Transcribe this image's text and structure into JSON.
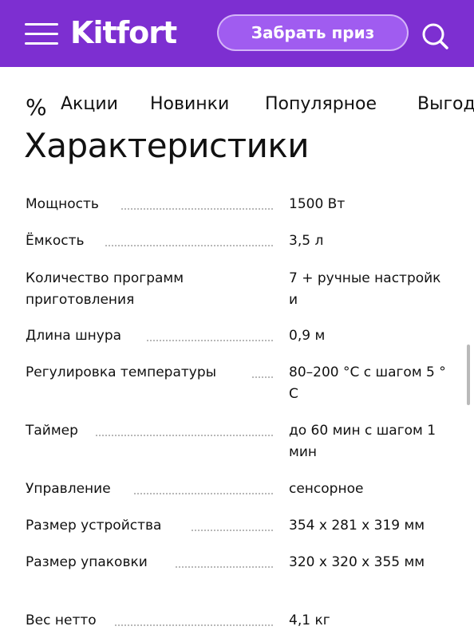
{
  "header": {
    "logo": "Kitfort",
    "prize_button": "Забрать приз",
    "menu_icon": "hamburger-menu-icon",
    "search_icon": "search-icon",
    "bg_color": "#7d2fd1",
    "button_color": "#a05cf0"
  },
  "nav": {
    "percent_symbol": "%",
    "items": [
      "Акции",
      "Новинки",
      "Популярное",
      "Выгод"
    ]
  },
  "page_title": "Характеристики",
  "specs": [
    {
      "name": "Мощность",
      "value": "1500 Вт"
    },
    {
      "name": "Ёмкость",
      "value": "3,5 л"
    },
    {
      "name": "Количество программ приготовления",
      "value": "7 + ручные настройки"
    },
    {
      "name": "Длина шнура",
      "value": "0,9 м"
    },
    {
      "name": "Регулировка температуры",
      "value": "80–200 °C с шагом 5 °C"
    },
    {
      "name": "Таймер",
      "value": "до 60 мин с шагом 1 мин"
    },
    {
      "name": "Управление",
      "value": "сенсорное"
    },
    {
      "name": "Размер устройства",
      "value": "354 x 281 x 319 мм"
    },
    {
      "name": "Размер упаковки",
      "value": "320 x 320 x 355 мм"
    },
    {
      "name": "Вес нетто",
      "value": "4,1 кг"
    }
  ]
}
